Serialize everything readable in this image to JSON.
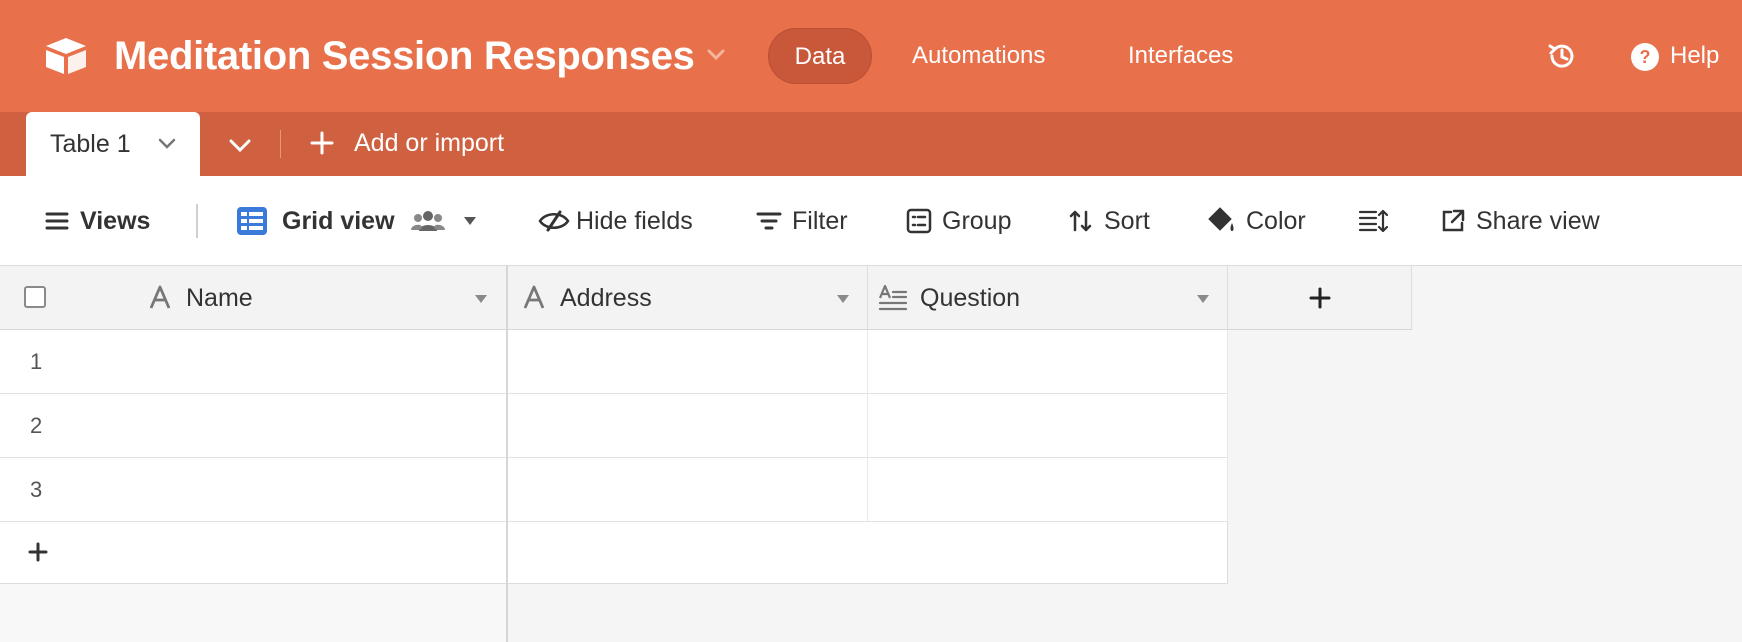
{
  "app": {
    "base_title": "Meditation Session Responses",
    "nav": {
      "data": "Data",
      "automations": "Automations",
      "interfaces": "Interfaces",
      "help": "Help"
    },
    "colors": {
      "header": "#e8704a",
      "tablebar": "#cf6141",
      "active_nav": "#c9583a"
    }
  },
  "tables": {
    "active_tab": "Table 1",
    "add_label": "Add or import"
  },
  "toolbar": {
    "views": "Views",
    "grid_view": "Grid view",
    "hide_fields": "Hide fields",
    "filter": "Filter",
    "group": "Group",
    "sort": "Sort",
    "color": "Color",
    "share_view": "Share view"
  },
  "grid": {
    "columns": [
      {
        "label": "Name",
        "icon": "single-line-text-icon"
      },
      {
        "label": "Address",
        "icon": "single-line-text-icon"
      },
      {
        "label": "Question",
        "icon": "long-text-icon"
      }
    ],
    "rows": [
      {
        "num": "1",
        "name": "",
        "address": "",
        "question": ""
      },
      {
        "num": "2",
        "name": "",
        "address": "",
        "question": ""
      },
      {
        "num": "3",
        "name": "",
        "address": "",
        "question": ""
      }
    ]
  }
}
